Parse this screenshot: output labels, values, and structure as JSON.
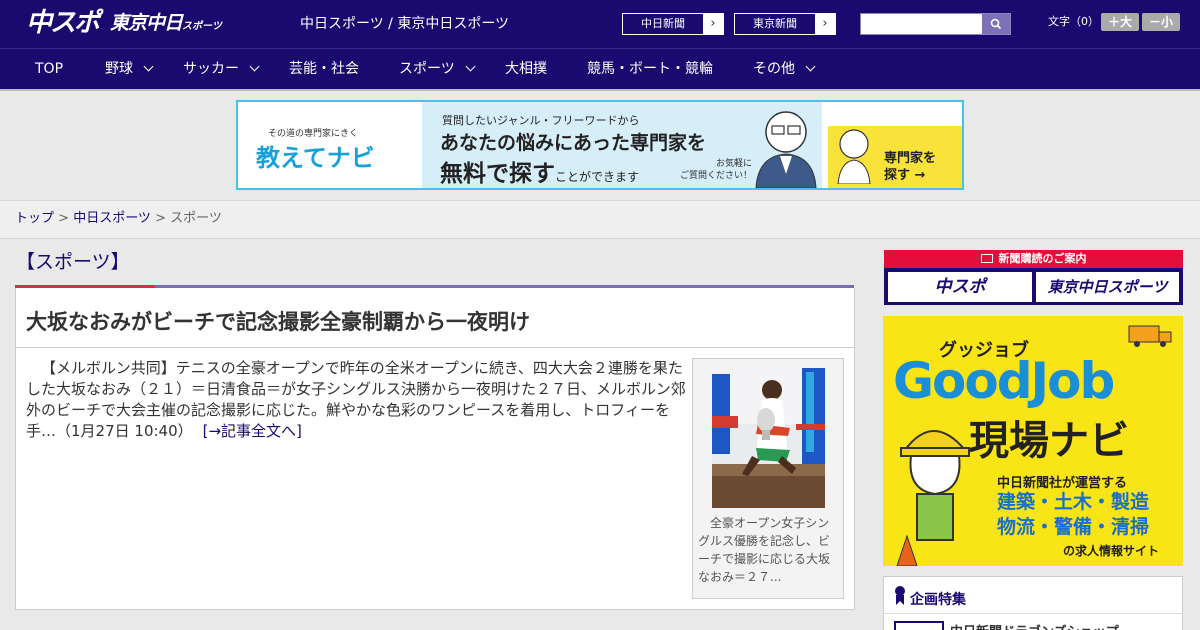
{
  "header": {
    "logo_main": "中スポ",
    "logo_sub_main": "東京中日",
    "logo_sub_small": "スポーツ",
    "links": "中日スポーツ / 東京中日スポーツ",
    "paper_buttons": [
      "中日新聞",
      "東京新聞"
    ],
    "search_placeholder": "",
    "font_size_label": "文字（0）",
    "font_plus": "＋大",
    "font_minus": "－小"
  },
  "nav": {
    "items": [
      {
        "label": "TOP",
        "dropdown": false
      },
      {
        "label": "野球",
        "dropdown": true
      },
      {
        "label": "サッカー",
        "dropdown": true
      },
      {
        "label": "芸能・社会",
        "dropdown": false
      },
      {
        "label": "スポーツ",
        "dropdown": true
      },
      {
        "label": "大相撲",
        "dropdown": false
      },
      {
        "label": "競馬・ボート・競輪",
        "dropdown": false
      },
      {
        "label": "その他",
        "dropdown": true
      }
    ]
  },
  "banner": {
    "sub": "その道の専門家にきく",
    "brand": "教えてナビ",
    "line1": "質問したいジャンル・フリーワードから",
    "line2": "あなたの悩みにあった専門家を",
    "line3_a": "無料で探す",
    "line3_b": "ことができます",
    "note": "お気軽に\nご質問ください！",
    "cta": "専門家を\n探す →"
  },
  "breadcrumb": {
    "top": "トップ",
    "section": "中日スポーツ",
    "current": "スポーツ"
  },
  "article": {
    "section_label": "【スポーツ】",
    "title": "大坂なおみがビーチで記念撮影全豪制覇から一夜明け",
    "body": "【メルボルン共同】テニスの全豪オープンで昨年の全米オープンに続き、四大大会２連勝を果たした大坂なおみ（２１）＝日清食品＝が女子シングルス決勝から一夜明けた２７日、メルボルン郊外のビーチで大会主催の記念撮影に応じた。鮮やかな色彩のワンピースを着用し、トロフィーを手…（1月27日 10:40）",
    "more": "[→記事全文へ]",
    "photo_caption": "全豪オープン女子シングルス優勝を記念し、ビーチで撮影に応じる大坂なおみ＝２７..."
  },
  "sidebar": {
    "subscription_head": "新聞購読のご案内",
    "subscription_buttons": [
      "中スポ",
      "東京中日スポーツ"
    ],
    "ad_kana": "グッジョブ",
    "ad_title": "GoodJob",
    "ad_sub": "現場ナビ",
    "ad_small": "中日新聞社が運営する",
    "ad_cats": "建築・土木・製造\n物流・警備・清掃",
    "ad_tail": "の求人情報サイト",
    "feature_head": "企画特集",
    "feature_item": "中日新聞ドラゴンズショップ"
  }
}
